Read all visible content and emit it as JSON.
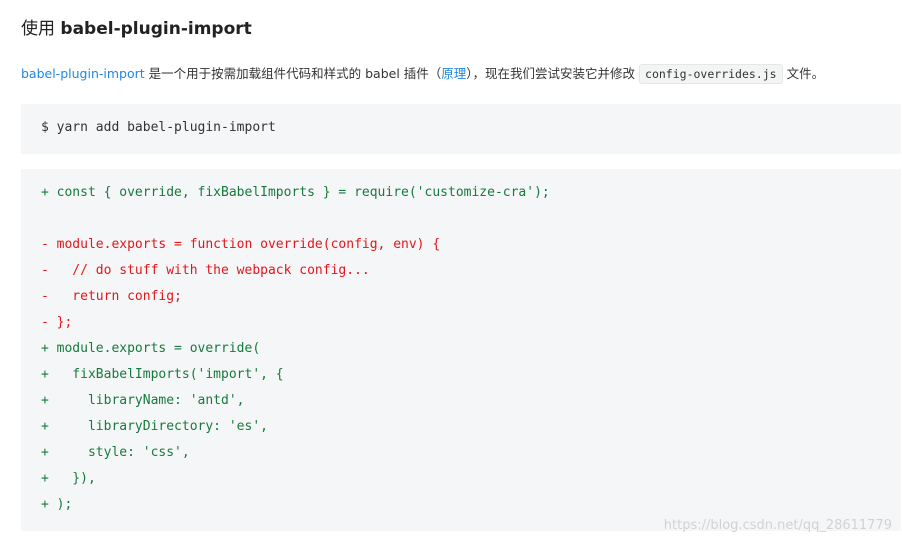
{
  "heading": {
    "prefix": "使用 ",
    "plugin": "babel-plugin-import"
  },
  "intro": {
    "plugin_link": "babel-plugin-import",
    "text_1": " 是一个用于按需加载组件代码和样式的 babel 插件（",
    "principle_link": "原理",
    "text_2": "），现在我们尝试安装它并修改 ",
    "file_code": "config-overrides.js",
    "text_3": " 文件。"
  },
  "install_block": {
    "command": "$ yarn add babel-plugin-import"
  },
  "diff_block": {
    "lines": [
      {
        "type": "add",
        "text": "+ const { override, fixBabelImports } = require('customize-cra');"
      },
      {
        "type": "blank",
        "text": ""
      },
      {
        "type": "del",
        "text": "- module.exports = function override(config, env) {"
      },
      {
        "type": "del",
        "text": "-   // do stuff with the webpack config..."
      },
      {
        "type": "del",
        "text": "-   return config;"
      },
      {
        "type": "del",
        "text": "- };"
      },
      {
        "type": "add",
        "text": "+ module.exports = override("
      },
      {
        "type": "add",
        "text": "+   fixBabelImports('import', {"
      },
      {
        "type": "add",
        "text": "+     libraryName: 'antd',"
      },
      {
        "type": "add",
        "text": "+     libraryDirectory: 'es',"
      },
      {
        "type": "add",
        "text": "+     style: 'css',"
      },
      {
        "type": "add",
        "text": "+   }),"
      },
      {
        "type": "add",
        "text": "+ );"
      }
    ]
  },
  "watermark": "https://blog.csdn.net/qq_28611779",
  "colors": {
    "link": "#1e88e5",
    "added": "#177a3d",
    "removed": "#e3161b",
    "code_bg": "#f5f6f7"
  }
}
